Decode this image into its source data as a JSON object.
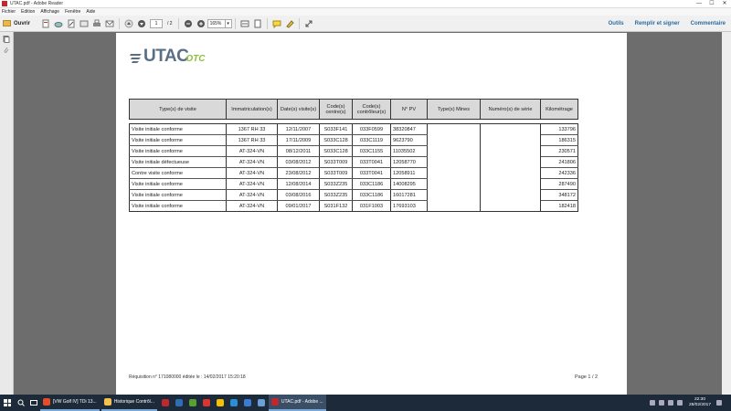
{
  "window": {
    "title": "UTAC.pdf - Adobe Reader",
    "buttons": [
      "—",
      "☐",
      "✕"
    ]
  },
  "menu": [
    "Fichier",
    "Edition",
    "Affichage",
    "Fenêtre",
    "Aide"
  ],
  "toolbar": {
    "open_label": "Ouvrir",
    "page_current": "1",
    "page_total": "/ 2",
    "zoom": "165%",
    "right_links": [
      "Outils",
      "Remplir et signer",
      "Commentaire"
    ]
  },
  "document": {
    "logo": {
      "brand": "UTAC",
      "sub": "OTC"
    },
    "table": {
      "headers": [
        "Type(s) de visite",
        "Immatriculation(s)",
        "Date(s) visite(s)",
        "Code(s) centre(s)",
        "Code(s) contrôleur(s)",
        "N° PV",
        "Type(s) Mines",
        "Numéro(s) de série",
        "Kilométrage"
      ],
      "rows": [
        [
          "Visite initiale conforme",
          "1367 RH 33",
          "12/11/2007",
          "S033F141",
          "033F0599",
          "38320847",
          "",
          "",
          "133796"
        ],
        [
          "Visite initiale conforme",
          "1367 RH 33",
          "17/11/2009",
          "S033C128",
          "033C1119",
          "9623790",
          "",
          "",
          "186315"
        ],
        [
          "Visite initiale conforme",
          "AT-324-VN",
          "08/12/2011",
          "S033C128",
          "033C1155",
          "11035502",
          "",
          "",
          "230571"
        ],
        [
          "Visite initiale défectueuse",
          "AT-324-VN",
          "03/08/2012",
          "S033T009",
          "033T0041",
          "12058770",
          "",
          "",
          "241806"
        ],
        [
          "Contre visite conforme",
          "AT-324-VN",
          "23/08/2012",
          "S033T009",
          "033T0041",
          "12058911",
          "",
          "",
          "242336"
        ],
        [
          "Visite initiale conforme",
          "AT-324-VN",
          "12/08/2014",
          "S033Z235",
          "033C1186",
          "14008295",
          "",
          "",
          "287490"
        ],
        [
          "Visite initiale conforme",
          "AT-324-VN",
          "03/08/2016",
          "S033Z235",
          "033C1186",
          "16017281",
          "",
          "",
          "348172"
        ],
        [
          "Visite initiale conforme",
          "AT-324-VN",
          "09/01/2017",
          "S031F132",
          "031F1003",
          "17693103",
          "",
          "",
          "182418"
        ]
      ]
    },
    "footer_left": "Réquisition n° 171080000 éditée le : 14/02/2017 15:20:18",
    "footer_right": "Page 1 / 2"
  },
  "taskbar": {
    "items": [
      {
        "label": "[VW Golf IV] TDi 13...",
        "color": "#e44d26"
      },
      {
        "label": "Historique Contrôl...",
        "color": "#f2c14e"
      },
      {
        "label": "UTAC.pdf - Adobe ...",
        "color": "#c1272d"
      }
    ],
    "pinned_colors": [
      "#c1272d",
      "#2f6db5",
      "#5aa02c",
      "#d33",
      "#f5c000",
      "#2a8fd6",
      "#3a7bd5",
      "#6aa0d8"
    ],
    "clock_time": "22:30",
    "clock_date": "28/02/2017"
  }
}
